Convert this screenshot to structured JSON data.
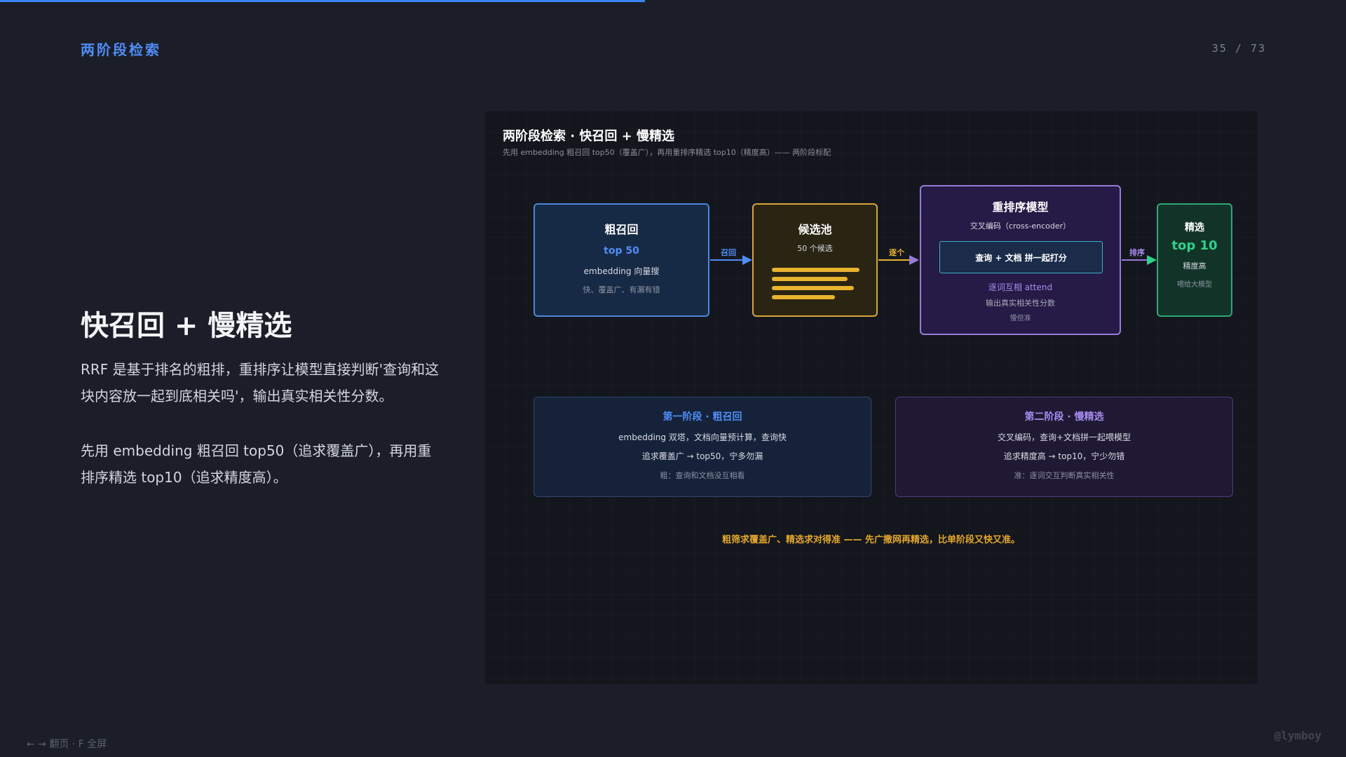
{
  "progress": {
    "fraction": 0.479,
    "color": "#3b82f6"
  },
  "header": {
    "section_title": "两阶段检索",
    "page_counter": "35 / 73"
  },
  "main": {
    "title": "快召回 + 慢精选",
    "paragraph_1": "RRF 是基于排名的粗排，重排序让模型直接判断'查询和这块内容放一起到底相关吗'，输出真实相关性分数。",
    "paragraph_2": "先用 embedding 粗召回 top50（追求覆盖广），再用重排序精选 top10（追求精度高）。"
  },
  "diagram": {
    "title": "两阶段检索 · 快召回 + 慢精选",
    "subtitle": "先用 embedding 粗召回 top50（覆盖广），再用重排序精选 top10（精度高）—— 两阶段标配",
    "recall": {
      "title": "粗召回",
      "highlight": "top 50",
      "line": "embedding 向量搜",
      "note": "快、覆盖广、有漏有错"
    },
    "pool": {
      "title": "候选池",
      "line": "50 个候选"
    },
    "rerank": {
      "title": "重排序模型",
      "line": "交叉编码（cross-encoder）",
      "inner": "查询 + 文档 拼一起打分",
      "highlight": "逐词互相 attend",
      "line2": "输出真实相关性分数",
      "note": "慢但准"
    },
    "select": {
      "title": "精选",
      "highlight": "top 10",
      "line": "精度高",
      "note": "喂给大模型"
    },
    "arrows": {
      "recall_label": "召回",
      "each_label": "逐个",
      "sort_label": "排序"
    },
    "stage_1": {
      "title": "第一阶段 · 粗召回",
      "line1": "embedding 双塔，文档向量预计算，查询快",
      "line2": "追求覆盖广 → top50，宁多勿漏",
      "note": "粗：查询和文档没互相看"
    },
    "stage_2": {
      "title": "第二阶段 · 慢精选",
      "line1": "交叉编码，查询+文档拼一起喂模型",
      "line2": "追求精度高 → top10，宁少勿错",
      "note": "准：逐词交互判断真实相关性"
    },
    "footer": "粗筛求覆盖广、精选求对得准 —— 先广撒网再精选，比单阶段又快又准。"
  },
  "nav_hint": "← → 翻页 · F 全屏",
  "watermark": "@lymboy",
  "colors": {
    "blue": "#4f8df7",
    "amber": "#e8b32f",
    "purple": "#9a7ad9",
    "green": "#2ed18a"
  }
}
